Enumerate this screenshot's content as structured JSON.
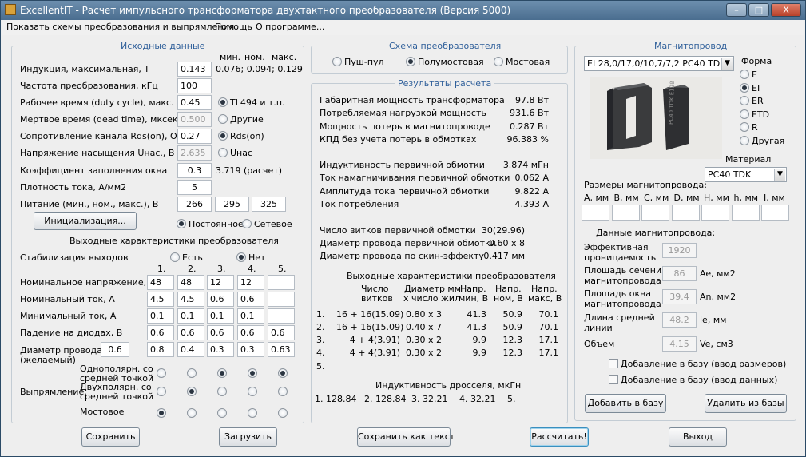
{
  "window": {
    "title": "ExcellentIT - Расчет импульсного трансформатора двухтактного преобразователя (Версия 5000)",
    "min": "–",
    "max": "□",
    "close": "X"
  },
  "menu": [
    "Показать схемы преобразования и выпрямления",
    "Помощь",
    "О программе..."
  ],
  "input": {
    "title": "Исходные данные",
    "hdr_min": "мин.",
    "hdr_nom": "ном.",
    "hdr_max": "макс.",
    "induction_label": "Индукция, максимальная, Т",
    "induction_value": "0.143",
    "induction_range": "0.076; 0.094; 0.129",
    "freq_label": "Частота преобразования, кГц",
    "freq_value": "100",
    "duty_label": "Рабочее время (duty cycle), макс.",
    "duty_value": "0.45",
    "duty_opt1": "TL494 и т.п.",
    "duty_opt2": "Другие",
    "dead_label": "Мертвое время (dead time), мксек",
    "dead_value": "0.500",
    "rds_label": "Сопротивление канала Rds(on), Ом",
    "rds_value": "0.27",
    "rds_opt": "Rds(on)",
    "usat_label": "Напряжение насыщения Uнас., В",
    "usat_value": "2.635",
    "usat_opt": "Uнас",
    "fill_label": "Коэффициент заполнения окна",
    "fill_value": "0.3",
    "fill_calc": "3.719 (расчет)",
    "density_label": "Плотность тока, А/мм2",
    "density_value": "5",
    "supply_label": "Питание (мин., ном., макс.), В",
    "supply_min": "266",
    "supply_nom": "295",
    "supply_max": "325",
    "init_button": "Инициализация...",
    "supply_dc": "Постоянное",
    "supply_ac": "Сетевое"
  },
  "outputs": {
    "title": "Выходные характеристики преобразователя",
    "stab_label": "Стабилизация выходов",
    "stab_yes": "Есть",
    "stab_no": "Нет",
    "cols": [
      "1.",
      "2.",
      "3.",
      "4.",
      "5."
    ],
    "vnom_label": "Номинальное напряжение, В",
    "vnom": [
      "48",
      "48",
      "12",
      "12",
      ""
    ],
    "inom_label": "Номинальный ток, А",
    "inom": [
      "4.5",
      "4.5",
      "0.6",
      "0.6",
      ""
    ],
    "imin_label": "Минимальный ток, А",
    "imin": [
      "0.1",
      "0.1",
      "0.1",
      "0.1",
      ""
    ],
    "vdrop_label": "Падение на диодах, В",
    "vdrop": [
      "0.6",
      "0.6",
      "0.6",
      "0.6",
      "0.6"
    ],
    "wire_label1": "Диаметр провода",
    "wire_label2": "(желаемый)",
    "wire_value": "0.6",
    "wire": [
      "0.8",
      "0.4",
      "0.3",
      "0.3",
      "0.63"
    ],
    "rect_label": "Выпрямление:",
    "rect_opt1a": "Однополярн. со",
    "rect_opt1b": "средней точкой",
    "rect_opt2a": "Двухполярн. со",
    "rect_opt2b": "средней точкой",
    "rect_opt3": "Мостовое"
  },
  "scheme": {
    "title": "Схема преобразователя",
    "opt1": "Пуш-пул",
    "opt2": "Полумостовая",
    "opt3": "Мостовая"
  },
  "results": {
    "title": "Результаты расчета",
    "lines": [
      {
        "label": "Габаритная мощность трансформатора",
        "value": "97.8 Вт"
      },
      {
        "label": "Потребляемая нагрузкой мощность",
        "value": "931.6 Вт"
      },
      {
        "label": "Мощность потерь в магнитопроводе",
        "value": "0.287 Вт"
      },
      {
        "label": "КПД без учета потерь в обмотках",
        "value": "96.383 %"
      },
      {
        "label": "Индуктивность первичной обмотки",
        "value": "3.874 мГн"
      },
      {
        "label": "Ток намагничивания первичной обмотки",
        "value": "0.062 А"
      },
      {
        "label": "Амплитуда тока первичной обмотки",
        "value": "9.822 А"
      },
      {
        "label": "Ток потребления",
        "value": "4.393 А"
      },
      {
        "label": "Число витков первичной обмотки",
        "value": "30(29.96)"
      },
      {
        "label": "Диаметр провода первичной обмотки",
        "value": "0.60 x 8"
      },
      {
        "label": "Диаметр провода по скин-эффекту",
        "value": "0.417 мм"
      }
    ],
    "out_title": "Выходные характеристики преобразователя",
    "col_turns": [
      "Число",
      "витков"
    ],
    "col_wire": [
      "Диаметр мм",
      "x число жил"
    ],
    "col_vmin": [
      "Напр.",
      "мин, В"
    ],
    "col_vnom": [
      "Напр.",
      "ном, В"
    ],
    "col_vmax": [
      "Напр.",
      "макс, В"
    ],
    "rows": [
      {
        "n": "1.",
        "turns": "16 + 16(15.09)",
        "wire": "0.80 x 3",
        "vmin": "41.3",
        "vnom": "50.9",
        "vmax": "70.1"
      },
      {
        "n": "2.",
        "turns": "16 + 16(15.09)",
        "wire": "0.40 x 7",
        "vmin": "41.3",
        "vnom": "50.9",
        "vmax": "70.1"
      },
      {
        "n": "3.",
        "turns": "4 + 4(3.91)",
        "wire": "0.30 x 2",
        "vmin": "9.9",
        "vnom": "12.3",
        "vmax": "17.1"
      },
      {
        "n": "4.",
        "turns": "4 + 4(3.91)",
        "wire": "0.30 x 2",
        "vmin": "9.9",
        "vnom": "12.3",
        "vmax": "17.1"
      },
      {
        "n": "5.",
        "turns": "",
        "wire": "",
        "vmin": "",
        "vnom": "",
        "vmax": ""
      }
    ],
    "ind_title": "Индуктивность дросселя, мкГн",
    "ind": [
      "1. 128.84",
      "2. 128.84",
      "3. 32.21",
      "4. 32.21",
      "5."
    ]
  },
  "core": {
    "title": "Магнитопровод",
    "select": "EI 28,0/17,0/10,7/7,2 PC40 TDK",
    "form_label": "Форма",
    "forms": [
      "E",
      "EI",
      "ER",
      "ETD",
      "R",
      "Другая"
    ],
    "img_text": "PC40  TDK  E128",
    "material_label": "Материал",
    "material": "PC40 TDK",
    "dims_label": "Размеры магнитопровода:",
    "dims": [
      "A, мм",
      "B, мм",
      "C, мм",
      "D, мм",
      "H, мм",
      "h, мм",
      "I, мм"
    ],
    "data_label": "Данные магнитопровода:",
    "eff_perm1": "Эффективная",
    "eff_perm2": "проницаемость",
    "eff_perm": "1920",
    "area1": "Площадь сечения",
    "area2": "магнитопровода",
    "area": "86",
    "area_unit": "Ae, мм2",
    "win1": "Площадь окна",
    "win2": "магнитопровода",
    "win": "39.4",
    "win_unit": "An, мм2",
    "len1": "Длина средней",
    "len2": "линии",
    "len": "48.2",
    "len_unit": "le, мм",
    "vol_label": "Объем",
    "vol": "4.15",
    "vol_unit": "Ve, см3",
    "add_dims": "Добавление в базу (ввод размеров)",
    "add_data": "Добавление в базу (ввод данных)",
    "add_btn": "Добавить в базу",
    "del_btn": "Удалить из базы"
  },
  "buttons": {
    "save": "Сохранить",
    "load": "Загрузить",
    "save_text": "Сохранить как текст",
    "calc": "Рассчитать!",
    "exit": "Выход"
  }
}
